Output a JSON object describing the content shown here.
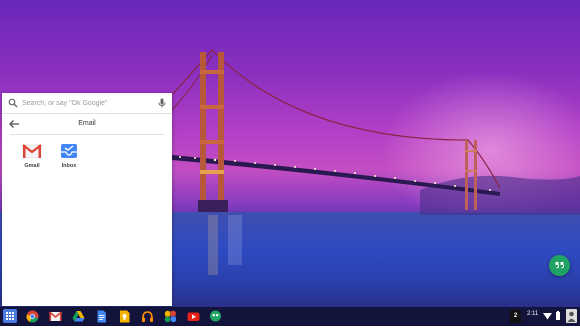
{
  "search": {
    "placeholder": "Search, or say \"Ok Google\""
  },
  "folder": {
    "title": "Email"
  },
  "apps": [
    {
      "label": "Gmail",
      "icon": "gmail-icon"
    },
    {
      "label": "Inbox",
      "icon": "inbox-icon"
    }
  ],
  "shelf": {
    "items": [
      "launcher-icon",
      "chrome-icon",
      "gmail-icon",
      "google-drive-icon",
      "google-docs-icon",
      "google-keep-icon",
      "google-play-music-icon",
      "google-photos-icon",
      "youtube-icon",
      "hangouts-icon"
    ]
  },
  "tray": {
    "workspace": "2",
    "clock": "2:11",
    "icons": [
      "wifi-icon",
      "battery-icon",
      "avatar"
    ]
  },
  "colors": {
    "accent": "#4a7be0",
    "hangouts": "#1fa463",
    "gmail_red": "#db4437"
  }
}
